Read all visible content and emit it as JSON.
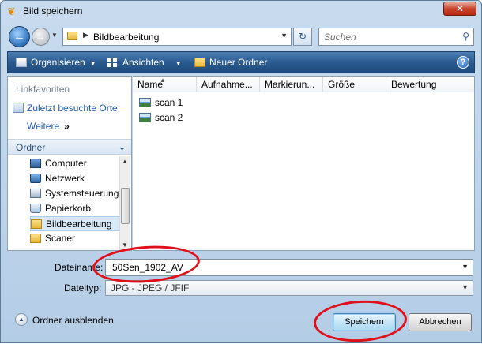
{
  "window": {
    "title": "Bild speichern",
    "close_label": "✕"
  },
  "address": {
    "path": "Bildbearbeitung",
    "search_placeholder": "Suchen"
  },
  "toolbar": {
    "organize": "Organisieren",
    "views": "Ansichten",
    "new_folder": "Neuer Ordner",
    "help": "?"
  },
  "sidebar": {
    "favorites_heading": "Linkfavoriten",
    "favorites": [
      {
        "label": "Zuletzt besuchte Orte",
        "icon": "recent-places-icon"
      },
      {
        "label": "Weitere",
        "icon": "more-icon"
      }
    ],
    "folders_heading": "Ordner",
    "tree": [
      {
        "label": "Computer",
        "icon": "computer-icon"
      },
      {
        "label": "Netzwerk",
        "icon": "network-icon"
      },
      {
        "label": "Systemsteuerung",
        "icon": "control-panel-icon"
      },
      {
        "label": "Papierkorb",
        "icon": "recycle-bin-icon"
      },
      {
        "label": "Bildbearbeitung",
        "icon": "folder-icon",
        "selected": true
      },
      {
        "label": "Scaner",
        "icon": "folder-icon"
      }
    ]
  },
  "file_list": {
    "columns": [
      "Name",
      "Aufnahme...",
      "Markierun...",
      "Größe",
      "Bewertung"
    ],
    "files": [
      {
        "name": "scan 1",
        "icon": "image-file-icon"
      },
      {
        "name": "scan 2",
        "icon": "image-file-icon"
      }
    ]
  },
  "form": {
    "filename_label": "Dateiname:",
    "filename_value": "50Sen_1902_AV",
    "filetype_label": "Dateityp:",
    "filetype_value": "JPG - JPEG / JFIF"
  },
  "footer": {
    "hide_folders": "Ordner ausblenden",
    "save": "Speichern",
    "cancel": "Abbrechen"
  },
  "colors": {
    "annotation": "#e0101a",
    "toolbar": "#2a5a8f",
    "link": "#1e5aa8"
  }
}
